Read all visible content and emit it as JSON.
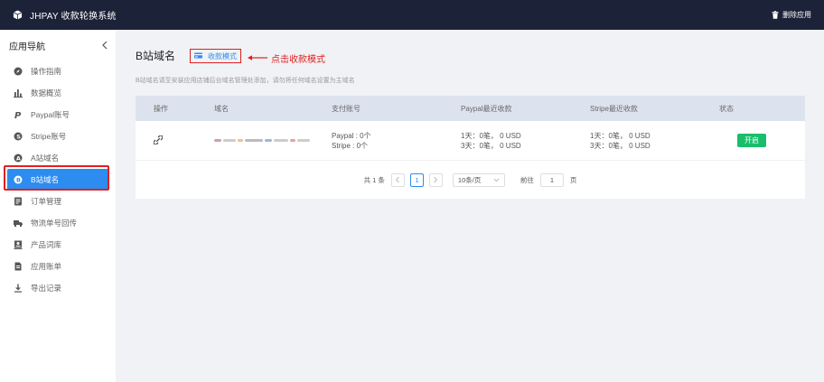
{
  "topbar": {
    "app_title": "JHPAY 收款轮换系统",
    "delete_app_label": "删除应用"
  },
  "sidebar": {
    "heading": "应用导航",
    "items": [
      {
        "label": "操作指南",
        "icon": "compass-icon"
      },
      {
        "label": "数据概览",
        "icon": "bar-chart-icon"
      },
      {
        "label": "Paypal账号",
        "icon": "paypal-icon"
      },
      {
        "label": "Stripe账号",
        "icon": "stripe-icon"
      },
      {
        "label": "A站域名",
        "icon": "a-circle-icon"
      },
      {
        "label": "B站域名",
        "icon": "b-circle-icon",
        "active": true
      },
      {
        "label": "订单管理",
        "icon": "order-list-icon"
      },
      {
        "label": "物流单号回传",
        "icon": "truck-icon"
      },
      {
        "label": "产品词库",
        "icon": "product-book-icon"
      },
      {
        "label": "应用账单",
        "icon": "bill-icon"
      },
      {
        "label": "导出记录",
        "icon": "download-icon"
      }
    ]
  },
  "main": {
    "title": "B站域名",
    "mode_button": "收款模式",
    "annotation": "点击收款模式",
    "hint": "B站域名请至安装应用店铺后台域名管理处添加，请勿将任何域名设置为主域名",
    "table": {
      "headers": [
        "操作",
        "域名",
        "支付账号",
        "Paypal最近收款",
        "Stripe最近收款",
        "状态"
      ],
      "rows": [
        {
          "payment_accounts": [
            "Paypal : 0个",
            "Stripe : 0个"
          ],
          "paypal_recent": [
            "1天：0笔，  0 USD",
            "3天：0笔，  0 USD"
          ],
          "stripe_recent": [
            "1天：0笔，  0 USD",
            "3天：0笔，  0 USD"
          ],
          "status_button": "开启"
        }
      ]
    },
    "pagination": {
      "total": "共 1 条",
      "current_page": "1",
      "page_size": "10条/页",
      "goto_prefix": "前往",
      "goto_value": "1",
      "goto_suffix": "页"
    }
  },
  "colors": {
    "topbar_bg": "#1c2238",
    "accent": "#2d8cf0",
    "status_on": "#19be6b",
    "annotation_red": "#e02020"
  }
}
